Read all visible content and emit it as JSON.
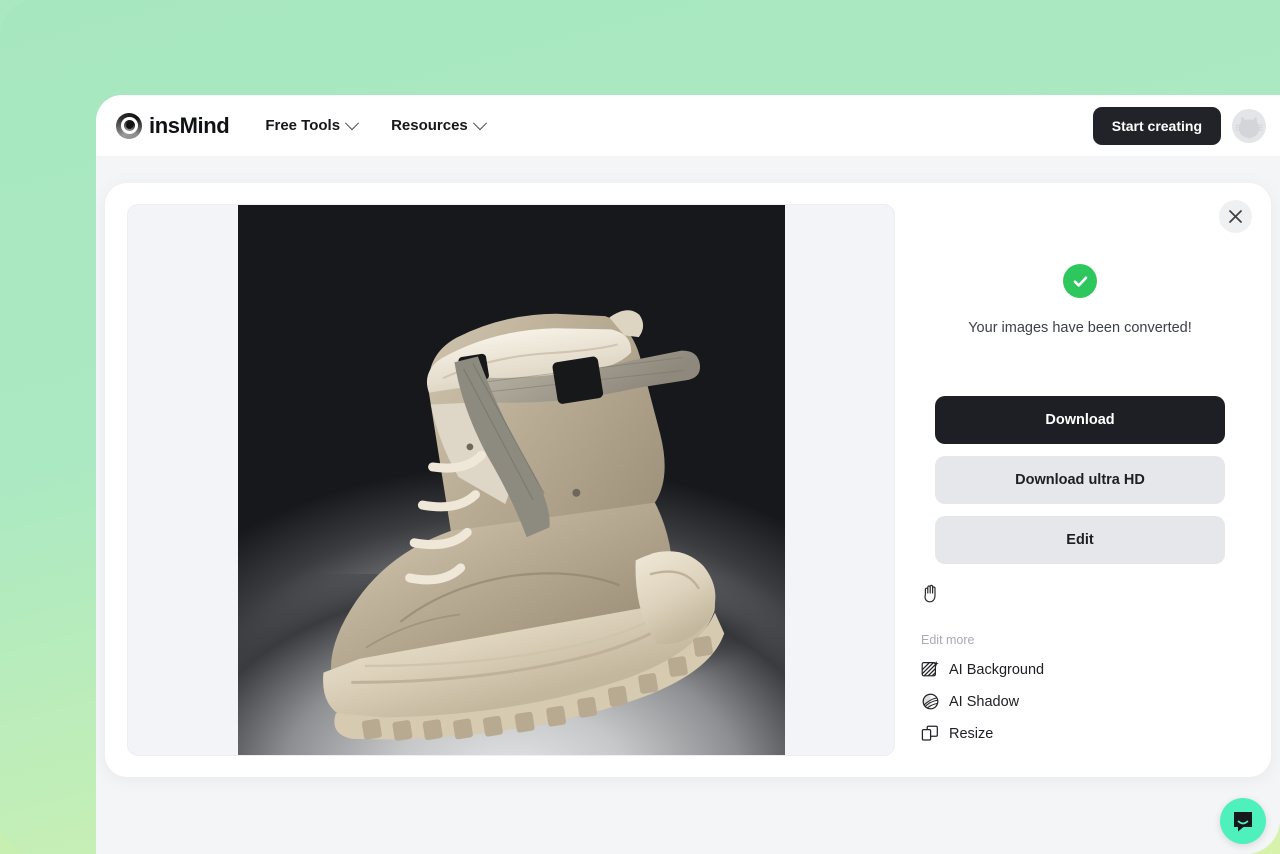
{
  "theme": {
    "page_gradient_top": "#a9e8c1",
    "page_gradient_bottom": "#d7f2ab",
    "accent_dark": "#1e1f24",
    "success_green": "#2ec75e",
    "chat_green": "#4ef0bb",
    "panel_gray": "#f2f4f7"
  },
  "topbar": {
    "brand_name": "insMind",
    "brand_logo_icon": "concentric-circles-logo",
    "nav": [
      {
        "label": "Free Tools",
        "icon": "chevron-down-icon"
      },
      {
        "label": "Resources",
        "icon": "chevron-down-icon"
      }
    ],
    "start_creating_label": "Start creating",
    "avatar_icon": "cat-avatar-icon"
  },
  "modal": {
    "close_icon": "close-icon",
    "preview": {
      "image_alt": "beige high-top sneaker boot on dark studio background",
      "background_color": "#f2f4f7"
    },
    "side": {
      "success_icon": "check-circle-icon",
      "success_text": "Your images have been converted!",
      "buttons": [
        {
          "label": "Download",
          "style": "primary"
        },
        {
          "label": "Download ultra HD",
          "style": "secondary"
        },
        {
          "label": "Edit",
          "style": "secondary"
        }
      ],
      "cursor_icon": "grab-hand-icon",
      "edit_more_label": "Edit more",
      "edit_more_items": [
        {
          "label": "AI Background",
          "icon": "ai-background-icon"
        },
        {
          "label": "AI Shadow",
          "icon": "ai-shadow-icon"
        },
        {
          "label": "Resize",
          "icon": "resize-icon"
        }
      ]
    }
  },
  "chat": {
    "icon": "chat-bubble-smile-icon"
  }
}
